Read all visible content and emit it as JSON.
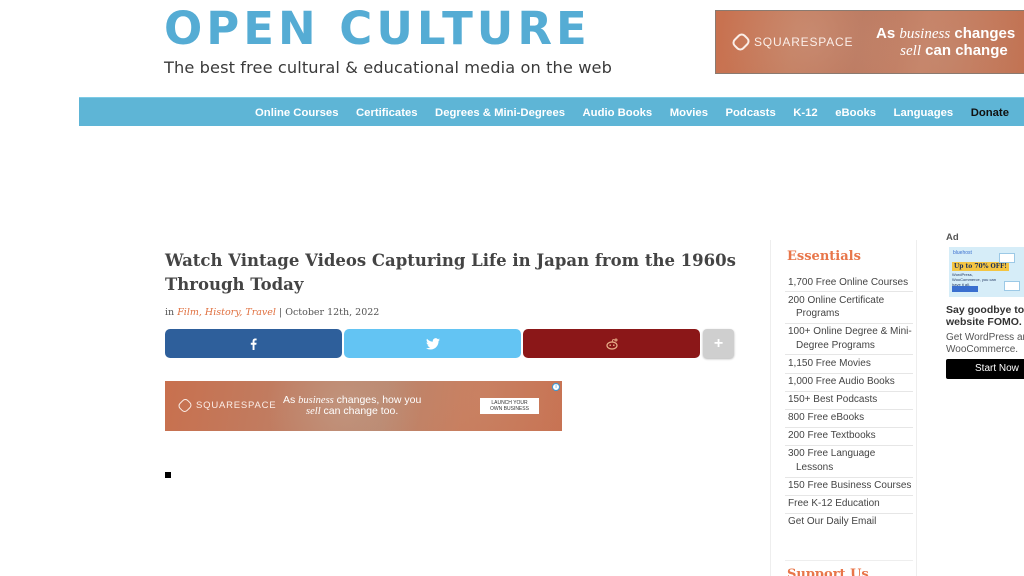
{
  "header": {
    "site_title": "OPEN CULTURE",
    "tagline": "The best free cultural & educational media on the web"
  },
  "top_ad": {
    "brand": "SQUARESPACE",
    "headline_prefix": "As ",
    "headline_italic": "business",
    "headline_suffix": " changes",
    "headline_line2_italic": "sell",
    "headline_line2": " can change"
  },
  "nav": {
    "items": [
      {
        "label": "Online Courses"
      },
      {
        "label": "Certificates"
      },
      {
        "label": "Degrees & Mini-Degrees"
      },
      {
        "label": "Audio Books"
      },
      {
        "label": "Movies"
      },
      {
        "label": "Podcasts"
      },
      {
        "label": "K-12"
      },
      {
        "label": "eBooks"
      },
      {
        "label": "Languages"
      },
      {
        "label": "Donate"
      }
    ],
    "bar_color": "#5eb5d6"
  },
  "article": {
    "title": "Watch Vintage Videos Capturing Life in Japan from the 1960s Through Today",
    "meta_prefix": "in ",
    "categories": [
      "Film",
      "History",
      "Travel"
    ],
    "category_sep": ", ",
    "date": "October 12th, 2022",
    "date_sep": " | "
  },
  "share": {
    "facebook_icon": "facebook-icon",
    "twitter_icon": "twitter-icon",
    "reddit_icon": "reddit-icon",
    "more_label": "+",
    "colors": {
      "facebook": "#2e5f9b",
      "twitter": "#63c4f3",
      "reddit": "#8b1718",
      "more": "#cfcfcf"
    }
  },
  "mid_ad": {
    "brand": "SQUARESPACE",
    "headline_prefix": "As ",
    "headline_italic": "business",
    "headline_suffix": " changes, how you",
    "headline_line2_italic": "sell",
    "headline_line2": " can change too.",
    "cta_line1": "LAUNCH YOUR",
    "cta_line2": "OWN BUSINESS",
    "info_icon": "i"
  },
  "sidebar": {
    "heading": "Essentials",
    "items": [
      {
        "label": "1,700 Free Online Courses"
      },
      {
        "label": "200 Online Certificate Programs"
      },
      {
        "label": "100+ Online Degree & Mini-Degree Programs"
      },
      {
        "label": "1,150 Free Movies"
      },
      {
        "label": "1,000 Free Audio Books"
      },
      {
        "label": "150+ Best Podcasts"
      },
      {
        "label": "800 Free eBooks"
      },
      {
        "label": "200 Free Textbooks"
      },
      {
        "label": "300 Free Language Lessons"
      },
      {
        "label": "150 Free Business Courses"
      },
      {
        "label": "Free K-12 Education"
      },
      {
        "label": "Get Our Daily Email"
      }
    ],
    "support_heading": "Support Us",
    "accent_color": "#e8764a"
  },
  "right_ad": {
    "label": "Ad",
    "image_brand": "bluehost",
    "image_badge": "Up to 70% OFF!",
    "image_sub": "WordPress, WooCommerce, you can have it all.",
    "headline_line1": "Say goodbye to",
    "headline_line2": "website FOMO.",
    "body_line1": "Get WordPress and",
    "body_line2": "WooCommerce.",
    "button": "Start Now"
  }
}
